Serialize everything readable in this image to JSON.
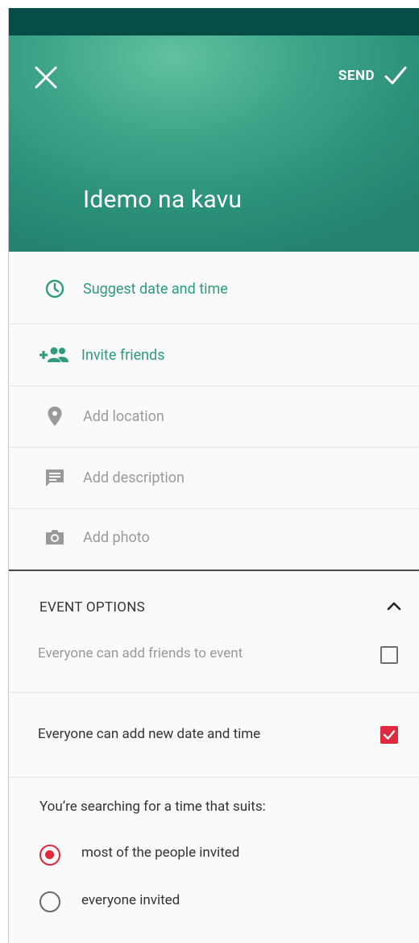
{
  "header": {
    "send_label": "SEND",
    "event_title": "Idemo na kavu"
  },
  "actions": [
    {
      "label": "Suggest date and time",
      "icon": "clock-icon"
    },
    {
      "label": "Invite friends",
      "icon": "add-people-icon"
    },
    {
      "label": "Add location",
      "icon": "location-pin-icon"
    },
    {
      "label": "Add description",
      "icon": "comment-icon"
    },
    {
      "label": "Add photo",
      "icon": "camera-icon"
    }
  ],
  "options": {
    "title": "EVENT OPTIONS",
    "add_friends": {
      "label": "Everyone can add friends to event",
      "checked": false
    },
    "add_date_time": {
      "label": "Everyone can add new date and time",
      "checked": true
    },
    "search_label": "You’re searching for a time that suits:",
    "radio": [
      {
        "label": "most of the people invited",
        "selected": true
      },
      {
        "label": "everyone invited",
        "selected": false
      }
    ]
  },
  "colors": {
    "header_start": "#5fc1a0",
    "header_end": "#23836e",
    "statusbar": "#064d47",
    "accent_green": "#2e9a7e",
    "accent_red": "#e0283f"
  }
}
